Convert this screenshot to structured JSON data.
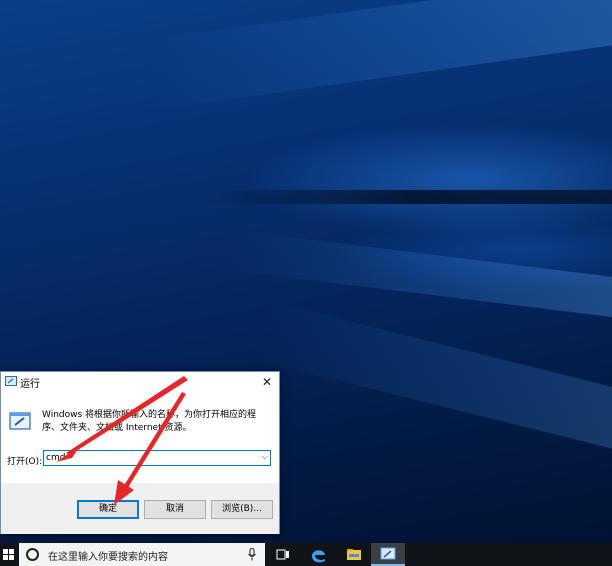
{
  "dialog": {
    "title": "运行",
    "close_label": "✕",
    "description": "Windows 将根据你所输入的名称，为你打开相应的程序、文件夹、文档或 Internet 资源。",
    "open_label": "打开(O):",
    "input_value": "cmd",
    "ok_label": "确定",
    "cancel_label": "取消",
    "browse_label": "浏览(B)..."
  },
  "taskbar": {
    "search_placeholder": "在这里输入你要搜索的内容",
    "icons": [
      "windows-start-icon",
      "task-view-icon",
      "edge-icon",
      "file-explorer-icon",
      "run-icon"
    ]
  },
  "colors": {
    "accent": "#0078d7",
    "arrow": "#e52727",
    "taskbar": "#101418"
  }
}
